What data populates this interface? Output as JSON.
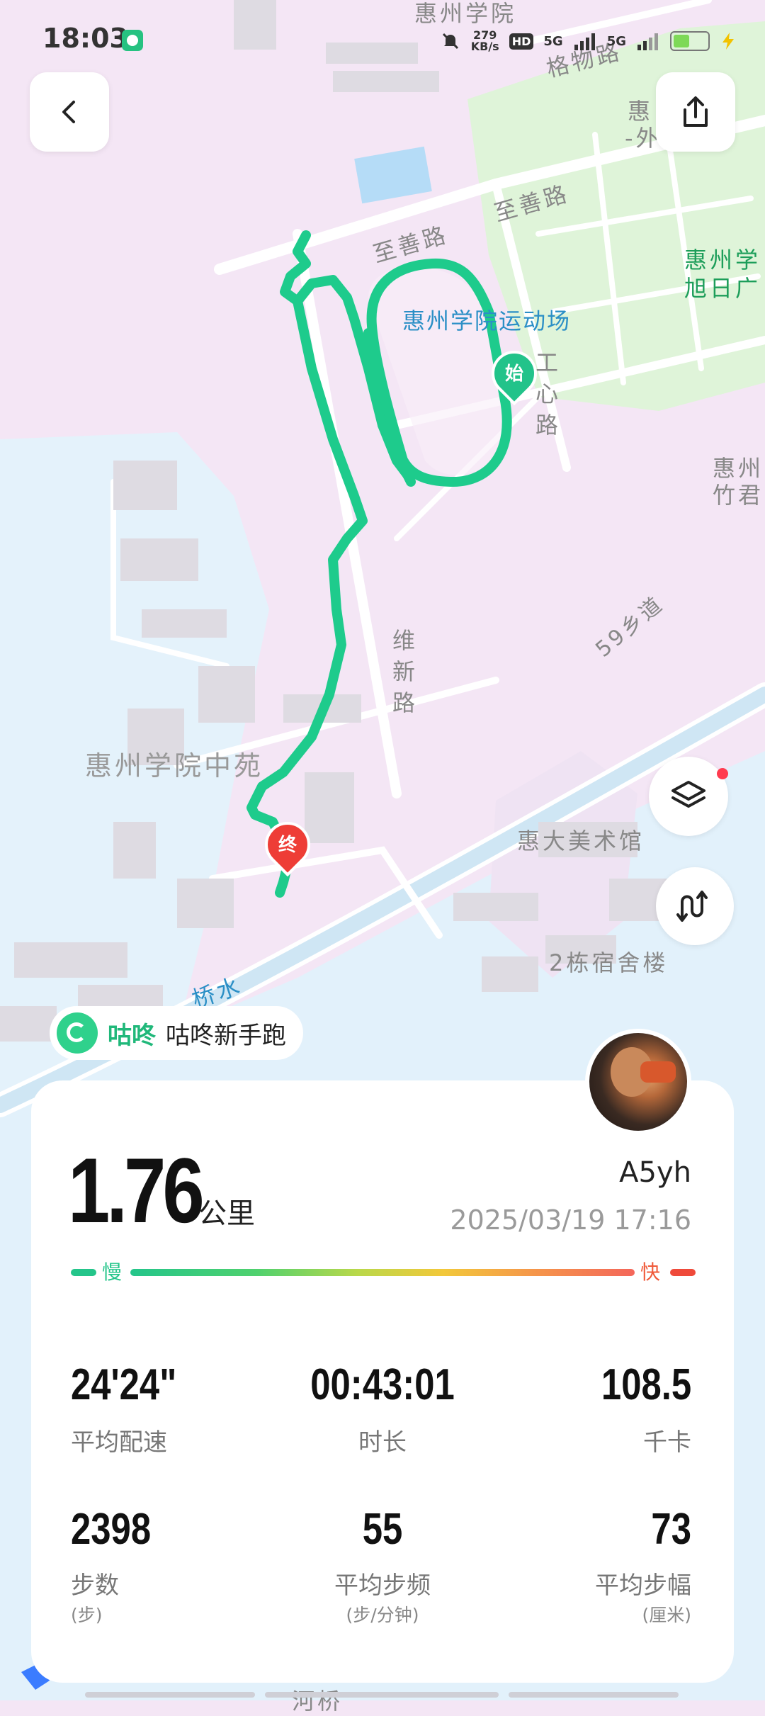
{
  "status_bar": {
    "time": "18:03",
    "net_speed_value": "279",
    "net_speed_unit": "KB/s",
    "hd": "HD",
    "sig1": "5G",
    "sig2": "5G"
  },
  "map": {
    "labels": {
      "huizhou_college_top": "惠州学院",
      "gewu_road": "格物路",
      "zhishan_road_1": "至善路",
      "zhishan_road_2": "至善路",
      "stadium": "惠州学院运动场",
      "huizhou_wai_1": "惠",
      "huizhou_wai_2": "-外",
      "huizhou_xu_1": "惠州学",
      "huizhou_xu_2": "旭日广",
      "huizhou_zhu_1": "惠州",
      "huizhou_zhu_2": "竹君",
      "gongxin_road": "工心路",
      "weixin_road": "维新路",
      "county_road": "59乡道",
      "zhongyuan": "惠州学院中苑",
      "art_building": "惠大美术馆",
      "dorm_2": "2栋宿舍楼",
      "river_1": "桥水",
      "river_2": "河桥"
    },
    "start_marker": "始",
    "end_marker": "终"
  },
  "source": {
    "brand": "咕咚",
    "name": "咕咚新手跑"
  },
  "summary": {
    "distance": "1.76",
    "distance_unit": "公里",
    "user_name": "A5yh",
    "datetime": "2025/03/19 17:16",
    "pace_slow": "慢",
    "pace_fast": "快"
  },
  "stats": [
    {
      "value": "24'24\"",
      "label": "平均配速",
      "sub": ""
    },
    {
      "value": "00:43:01",
      "label": "时长",
      "sub": ""
    },
    {
      "value": "108.5",
      "label": "千卡",
      "sub": ""
    },
    {
      "value": "2398",
      "label": "步数",
      "sub": "(步)"
    },
    {
      "value": "55",
      "label": "平均步频",
      "sub": "(步/分钟)"
    },
    {
      "value": "73",
      "label": "平均步幅",
      "sub": "(厘米)"
    }
  ],
  "colors": {
    "route": "#1ecb8c",
    "map_pink": "#f4e6f5",
    "map_water": "#e2f1fb",
    "map_green": "#dff4d9",
    "start": "#22c38a",
    "end": "#ee3d36"
  }
}
